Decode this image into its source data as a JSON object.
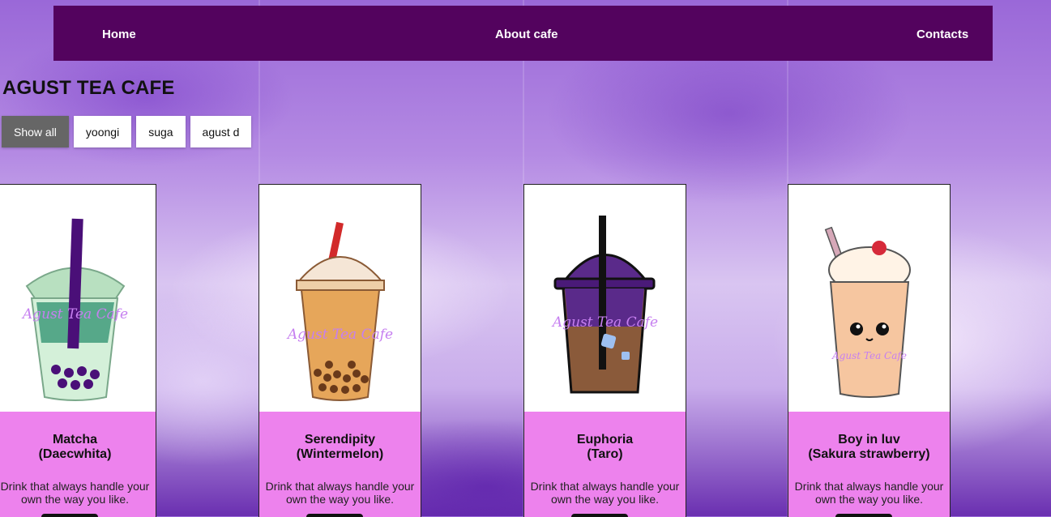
{
  "nav": {
    "home": "Home",
    "about": "About cafe",
    "contacts": "Contacts"
  },
  "brand": "AGUST TEA CAFE",
  "filters": [
    {
      "label": "Show all",
      "active": true
    },
    {
      "label": "yoongi",
      "active": false
    },
    {
      "label": "suga",
      "active": false
    },
    {
      "label": "agust d",
      "active": false
    }
  ],
  "cards": [
    {
      "name_line1": "Matcha",
      "name_line2": "(Daecwhita)",
      "desc_line1": "Drink that always handle your",
      "desc_line2": "own the way you like.",
      "cup_text": "Agust Tea Cafe"
    },
    {
      "name_line1": "Serendipity",
      "name_line2": "(Wintermelon)",
      "desc_line1": "Drink that always handle your",
      "desc_line2": "own the way you like.",
      "cup_text": "Agust Tea Cafe"
    },
    {
      "name_line1": "Euphoria",
      "name_line2": "(Taro)",
      "desc_line1": "Drink that always handle your",
      "desc_line2": "own the way you like.",
      "cup_text": "Agust Tea Cafe"
    },
    {
      "name_line1": "Boy in luv",
      "name_line2": "(Sakura strawberry)",
      "desc_line1": "Drink that always handle your",
      "desc_line2": "own the way you like.",
      "cup_text": "Agust Tea Cafe"
    }
  ]
}
